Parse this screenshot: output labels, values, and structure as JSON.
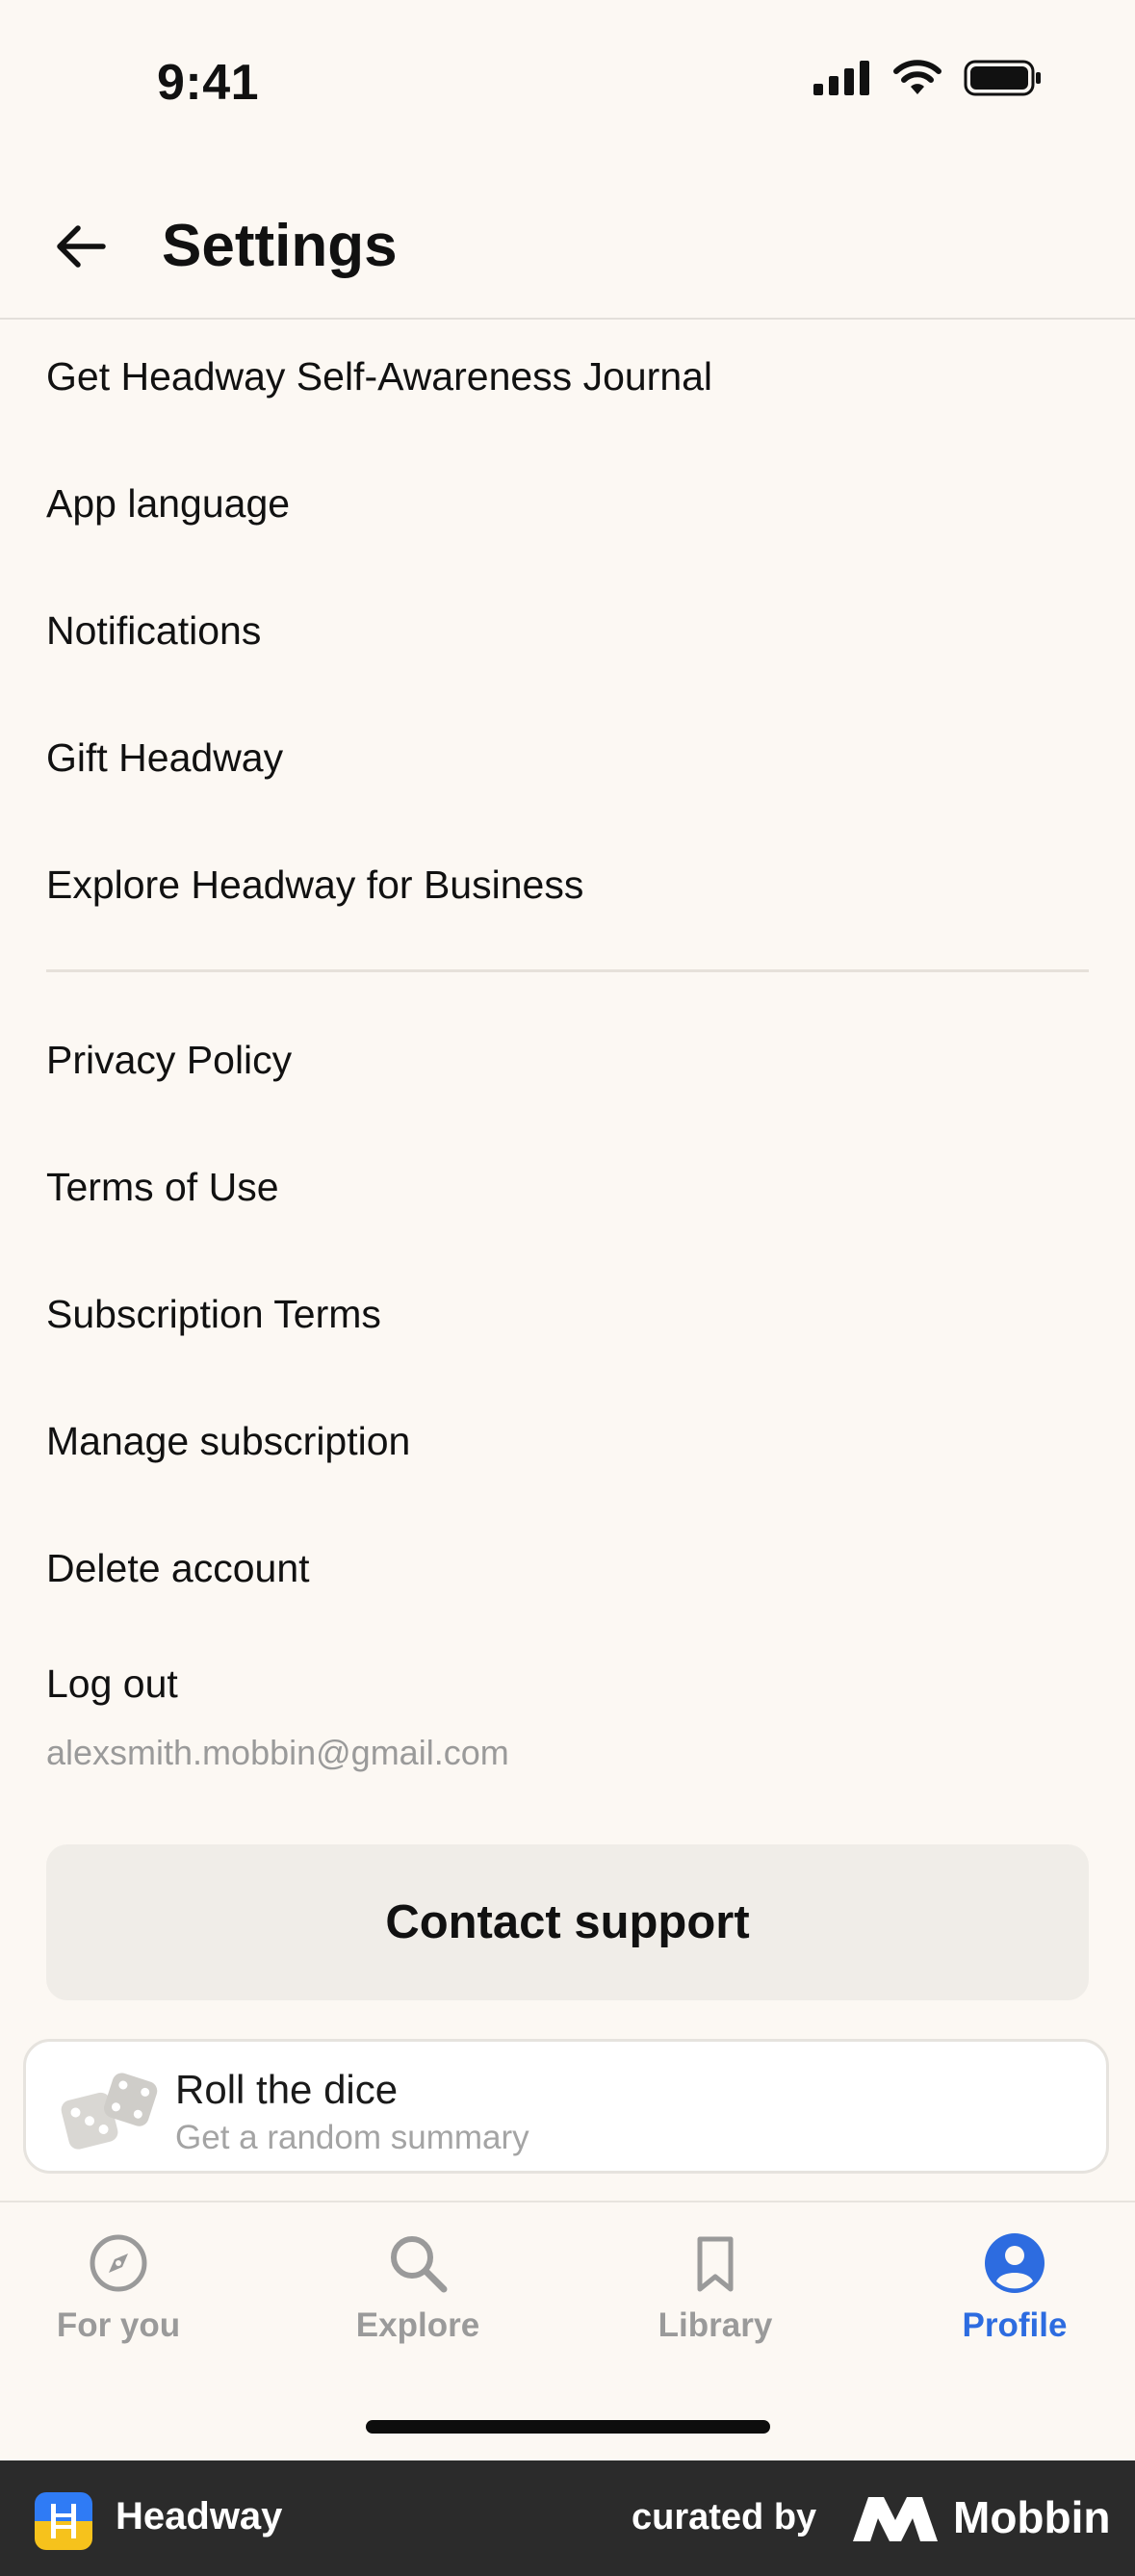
{
  "status_bar": {
    "time": "9:41"
  },
  "header": {
    "title": "Settings"
  },
  "menu": {
    "group1": [
      "Get Headway Self-Awareness Journal",
      "App language",
      "Notifications",
      "Gift Headway",
      "Explore Headway for Business"
    ],
    "group2": [
      "Privacy Policy",
      "Terms of Use",
      "Subscription Terms",
      "Manage subscription",
      "Delete account",
      "Log out"
    ],
    "account_email": "alexsmith.mobbin@gmail.com"
  },
  "contact_support_label": "Contact support",
  "dice_card": {
    "title": "Roll the dice",
    "subtitle": "Get a random summary",
    "icon": "dice-icon"
  },
  "tabbar": {
    "tabs": [
      {
        "label": "For you",
        "icon": "compass-icon"
      },
      {
        "label": "Explore",
        "icon": "search-icon"
      },
      {
        "label": "Library",
        "icon": "bookmark-icon"
      },
      {
        "label": "Profile",
        "icon": "profile-icon"
      }
    ],
    "active_tab": "Profile",
    "active_color": "#2d6ce0",
    "inactive_color": "#9a9a9a"
  },
  "footer": {
    "app_name": "Headway",
    "curated_by": "curated by",
    "brand": "Mobbin"
  }
}
